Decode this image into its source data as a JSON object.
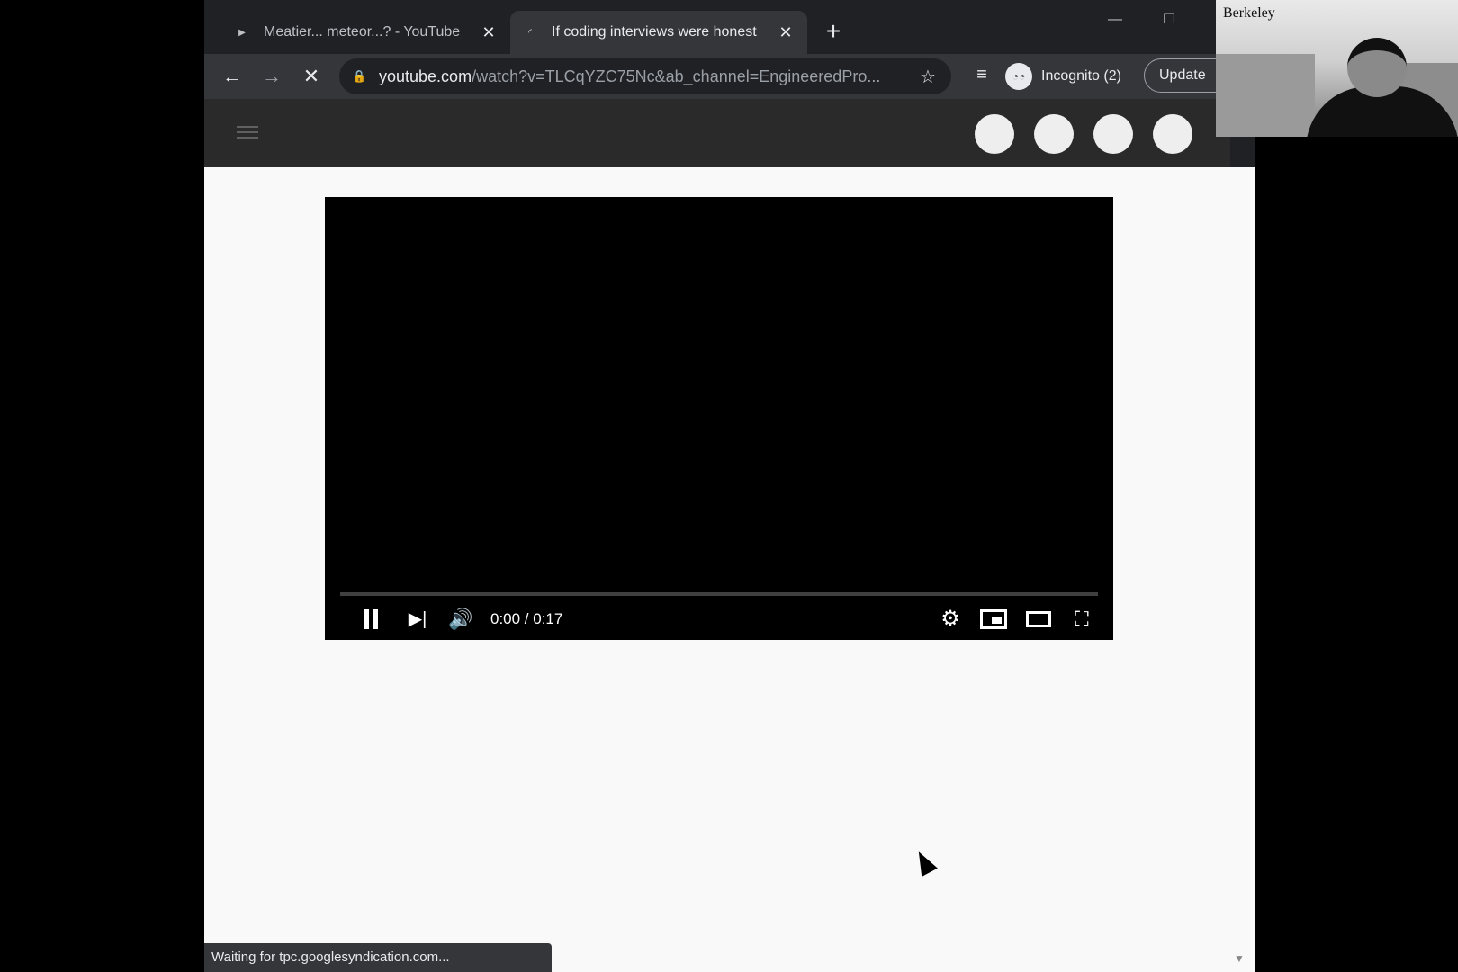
{
  "tabs": [
    {
      "title": "Meatier... meteor...? - YouTube",
      "favicon": "play-icon",
      "close": "✕"
    },
    {
      "title": "If coding interviews were honest",
      "favicon": "loading-icon",
      "close": "✕"
    }
  ],
  "new_tab": "+",
  "window_controls": {
    "minimize": "—",
    "maximize": "☐"
  },
  "toolbar": {
    "back": "←",
    "forward": "→",
    "stop": "✕",
    "url_host": "youtube.com",
    "url_rest": "/watch?v=TLCqYZC75Nc&ab_channel=EngineeredPro...",
    "star": "☆",
    "reading_list": "≡",
    "incognito_label": "Incognito (2)",
    "update_label": "Update"
  },
  "player": {
    "time": "0:00 / 0:17",
    "progress": 0,
    "next": "▶|",
    "volume": "🔊",
    "settings": "⚙",
    "fullscreen": "⛶"
  },
  "status": "Waiting for tpc.googlesyndication.com...",
  "webcam": {
    "label": "Berkeley"
  },
  "colors": {
    "chrome_dark": "#202124",
    "toolbar": "#35363a",
    "page_bg": "#f9f9f9",
    "player": "#000000"
  }
}
